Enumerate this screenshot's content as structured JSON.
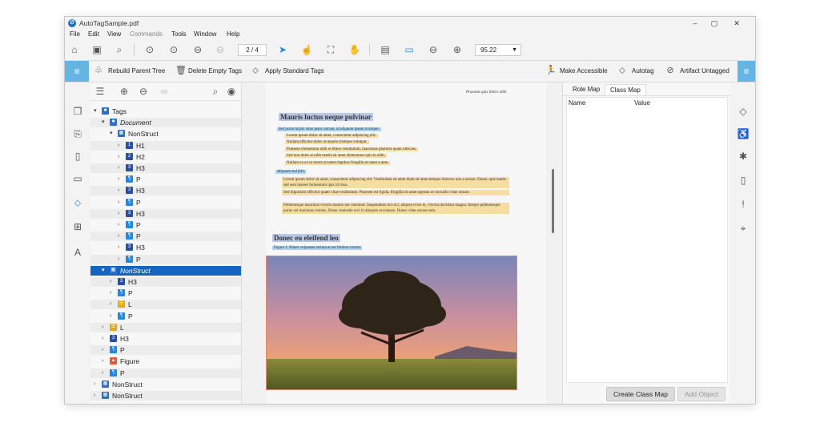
{
  "window": {
    "title": "AutoTagSample.pdf",
    "minimize": "–",
    "maximize": "▢",
    "close": "✕"
  },
  "menu": [
    "File",
    "Edit",
    "View",
    "Commands",
    "Tools",
    "Window",
    "Help"
  ],
  "toolbar": {
    "page_display": "2 / 4",
    "zoom_value": "95.22"
  },
  "toolbar2": {
    "rebuild": "Rebuild Parent Tree",
    "delete_empty": "Delete Empty Tags",
    "apply_standard": "Apply Standard Tags",
    "make_accessible": "Make Accessible",
    "autotag": "Autotag",
    "artifact_untagged": "Artifact Untagged"
  },
  "tags_tree": [
    {
      "label": "Tags",
      "type": "tags",
      "depth": 0,
      "twisty": "v"
    },
    {
      "label": "Document",
      "type": "doc",
      "depth": 1,
      "twisty": "v"
    },
    {
      "label": "NonStruct",
      "type": "ns",
      "depth": 2,
      "twisty": "v"
    },
    {
      "label": "H1",
      "type": "h",
      "icon": "1",
      "depth": 3,
      "twisty": ">"
    },
    {
      "label": "H2",
      "type": "h",
      "icon": "2",
      "depth": 3,
      "twisty": ">"
    },
    {
      "label": "H3",
      "type": "h",
      "icon": "3",
      "depth": 3,
      "twisty": ">"
    },
    {
      "label": "P",
      "type": "p",
      "depth": 3,
      "twisty": ">"
    },
    {
      "label": "H3",
      "type": "h",
      "icon": "3",
      "depth": 3,
      "twisty": ">"
    },
    {
      "label": "P",
      "type": "p",
      "depth": 3,
      "twisty": ">"
    },
    {
      "label": "H3",
      "type": "h",
      "icon": "3",
      "depth": 3,
      "twisty": ">"
    },
    {
      "label": "P",
      "type": "p",
      "depth": 3,
      "twisty": ">"
    },
    {
      "label": "P",
      "type": "p",
      "depth": 3,
      "twisty": ">"
    },
    {
      "label": "H3",
      "type": "h",
      "icon": "3",
      "depth": 3,
      "twisty": ">"
    },
    {
      "label": "P",
      "type": "p",
      "depth": 3,
      "twisty": ">"
    },
    {
      "label": "NonStruct",
      "type": "ns",
      "depth": 1,
      "twisty": "v",
      "selected": true
    },
    {
      "label": "H3",
      "type": "h",
      "icon": "3",
      "depth": 2,
      "twisty": ">"
    },
    {
      "label": "P",
      "type": "p",
      "depth": 2,
      "twisty": ">"
    },
    {
      "label": "L",
      "type": "l",
      "depth": 2,
      "twisty": ">"
    },
    {
      "label": "P",
      "type": "p",
      "depth": 2,
      "twisty": ">"
    },
    {
      "label": "L",
      "type": "l",
      "depth": 1,
      "twisty": ">"
    },
    {
      "label": "H3",
      "type": "h",
      "icon": "3",
      "depth": 1,
      "twisty": ">"
    },
    {
      "label": "P",
      "type": "p",
      "depth": 1,
      "twisty": ">"
    },
    {
      "label": "Figure",
      "type": "fig",
      "depth": 1,
      "twisty": ">"
    },
    {
      "label": "P",
      "type": "p",
      "depth": 1,
      "twisty": ">"
    },
    {
      "label": "NonStruct",
      "type": "ns",
      "depth": 0,
      "twisty": ">"
    },
    {
      "label": "NonStruct",
      "type": "ns",
      "depth": 0,
      "twisty": ">"
    }
  ],
  "document": {
    "running_header": "Praesent quis libero nibh",
    "heading1": "Mauris luctus neque pulvinar",
    "sub1": "Sed porta turpis vitae justo rutrum, id aliquam ipsum tristique.",
    "list1": [
      "Lorem ipsum dolor sit amet, consectetur adipiscing elit.",
      "Nullam efficitur dolor ut mauris tristique volutpat.",
      "Praesent elementum nibh et libero vestibulum, maecenas pharetra quam ultricies.",
      "Sed non dolor at nibh mattis sit amet elementum quis in nibh.",
      "Nullam ex ex ut lorem sit amet dapibus fringilla sit amet a ante."
    ],
    "sub2": "Aliquam sed felis",
    "list2": [
      "Lorem ipsum dolor sit amet, consectetur adipiscing elit. Vestibulum sit amet diam sit amet tempus rhoncus non a ornare. Donec quis mattis sed sem laoreet fermentum quis id risus.",
      "Sed dignissim efficitur quam vitae vestibulum. Praesent est ligula, fringilla sit amet egestas at convallis vitae ornare.",
      "Pellentesque maximus viverra mauris nec euismod. Suspendisse mi orci, aliquet et leo in, viverra tincidunt magna. Integer pellentesque purus vel maximus rutrum. Donec molestie orci in aliquam accumsan. Donec vitae ornare sem."
    ],
    "heading2": "Donec eu eleifend leo",
    "caption": "Figure 1. Etiam vulputate lacinia ut est finibus viverra"
  },
  "right_panel": {
    "tabs": [
      "Role Map",
      "Class Map"
    ],
    "active_tab": "Class Map",
    "columns": [
      "Name",
      "Value"
    ],
    "create_button": "Create Class Map",
    "add_button": "Add Object"
  },
  "colors": {
    "accent": "#64b5e0",
    "selection": "#1565c0"
  }
}
